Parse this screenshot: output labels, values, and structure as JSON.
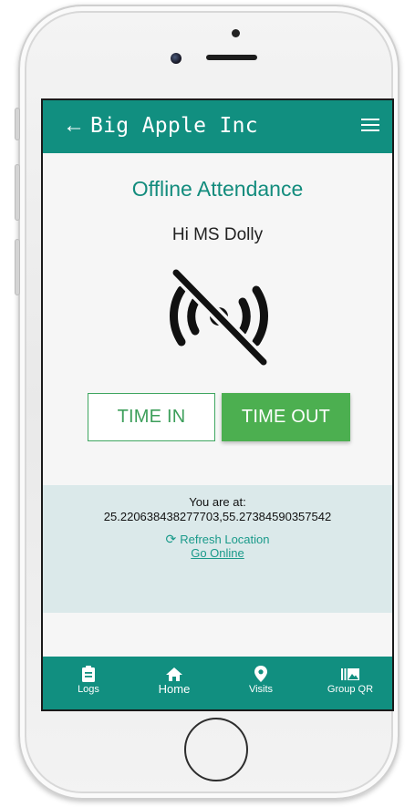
{
  "app": {
    "title": "Big Apple Inc",
    "back_icon": "arrow-left-icon",
    "menu_icon": "hamburger-menu-icon",
    "accent_color": "#118f80"
  },
  "main": {
    "page_title": "Offline Attendance",
    "greeting": "Hi MS Dolly",
    "status_icon": "wifi-off-icon",
    "time_in_label": "TIME IN",
    "time_out_label": "TIME OUT",
    "time_out_color": "#4caf50"
  },
  "location": {
    "label": "You are at:",
    "coordinates": "25.220638438277703,55.27384590357542",
    "refresh_label": "Refresh Location",
    "refresh_icon": "refresh-icon",
    "go_online_label": "Go Online"
  },
  "bottom_nav": {
    "items": [
      {
        "label": "Logs",
        "icon": "clipboard-icon"
      },
      {
        "label": "Home",
        "icon": "home-icon"
      },
      {
        "label": "Visits",
        "icon": "map-pin-icon"
      },
      {
        "label": "Group QR",
        "icon": "gallery-icon"
      }
    ]
  }
}
